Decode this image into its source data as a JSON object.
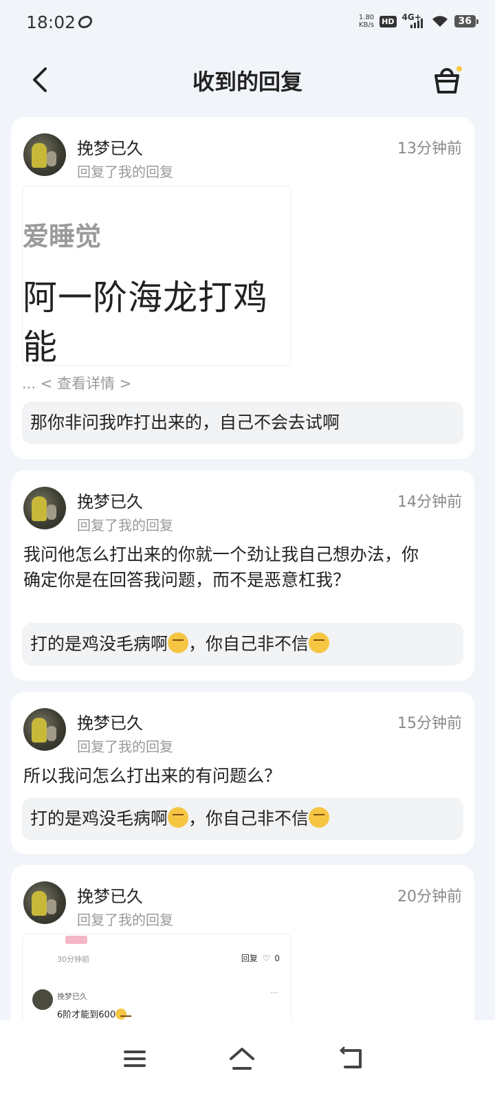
{
  "status_bar": {
    "time": "18:02",
    "speed_value": "1.80",
    "speed_unit": "KB/s",
    "hd": "HD",
    "network": "4G+",
    "battery": "36"
  },
  "header": {
    "title": "收到的回复"
  },
  "replies": [
    {
      "user": "挽梦已久",
      "action": "回复了我的回复",
      "time": "13分钟前",
      "image_sub": "爱睡觉",
      "image_main": "阿一阶海龙打鸡能",
      "more": "... < 查看详情 >",
      "quote": "那你非问我咋打出来的，自己不会去试啊"
    },
    {
      "user": "挽梦已久",
      "action": "回复了我的回复",
      "time": "14分钟前",
      "text": "我问他怎么打出来的你就一个劲让我自己想办法，你确定你是在回答我问题，而不是恶意杠我？",
      "quote_a": "打的是鸡没毛病啊",
      "quote_b": "，你自己非不信"
    },
    {
      "user": "挽梦已久",
      "action": "回复了我的回复",
      "time": "15分钟前",
      "text": "所以我问怎么打出来的有问题么？",
      "quote_a": "打的是鸡没毛病啊",
      "quote_b": "，你自己非不信"
    },
    {
      "user": "挽梦已久",
      "action": "回复了我的回复",
      "time": "20分钟前",
      "shot": {
        "time": "30分钟前",
        "reply_label": "回复",
        "like_count": "0",
        "user": "挽梦已久",
        "text": "6阶才能到600"
      }
    }
  ],
  "icons": {
    "back": "chevron-left-icon",
    "shop": "shopping-basket-icon",
    "menu": "menu-icon",
    "home": "home-icon",
    "back_nav": "return-icon"
  }
}
